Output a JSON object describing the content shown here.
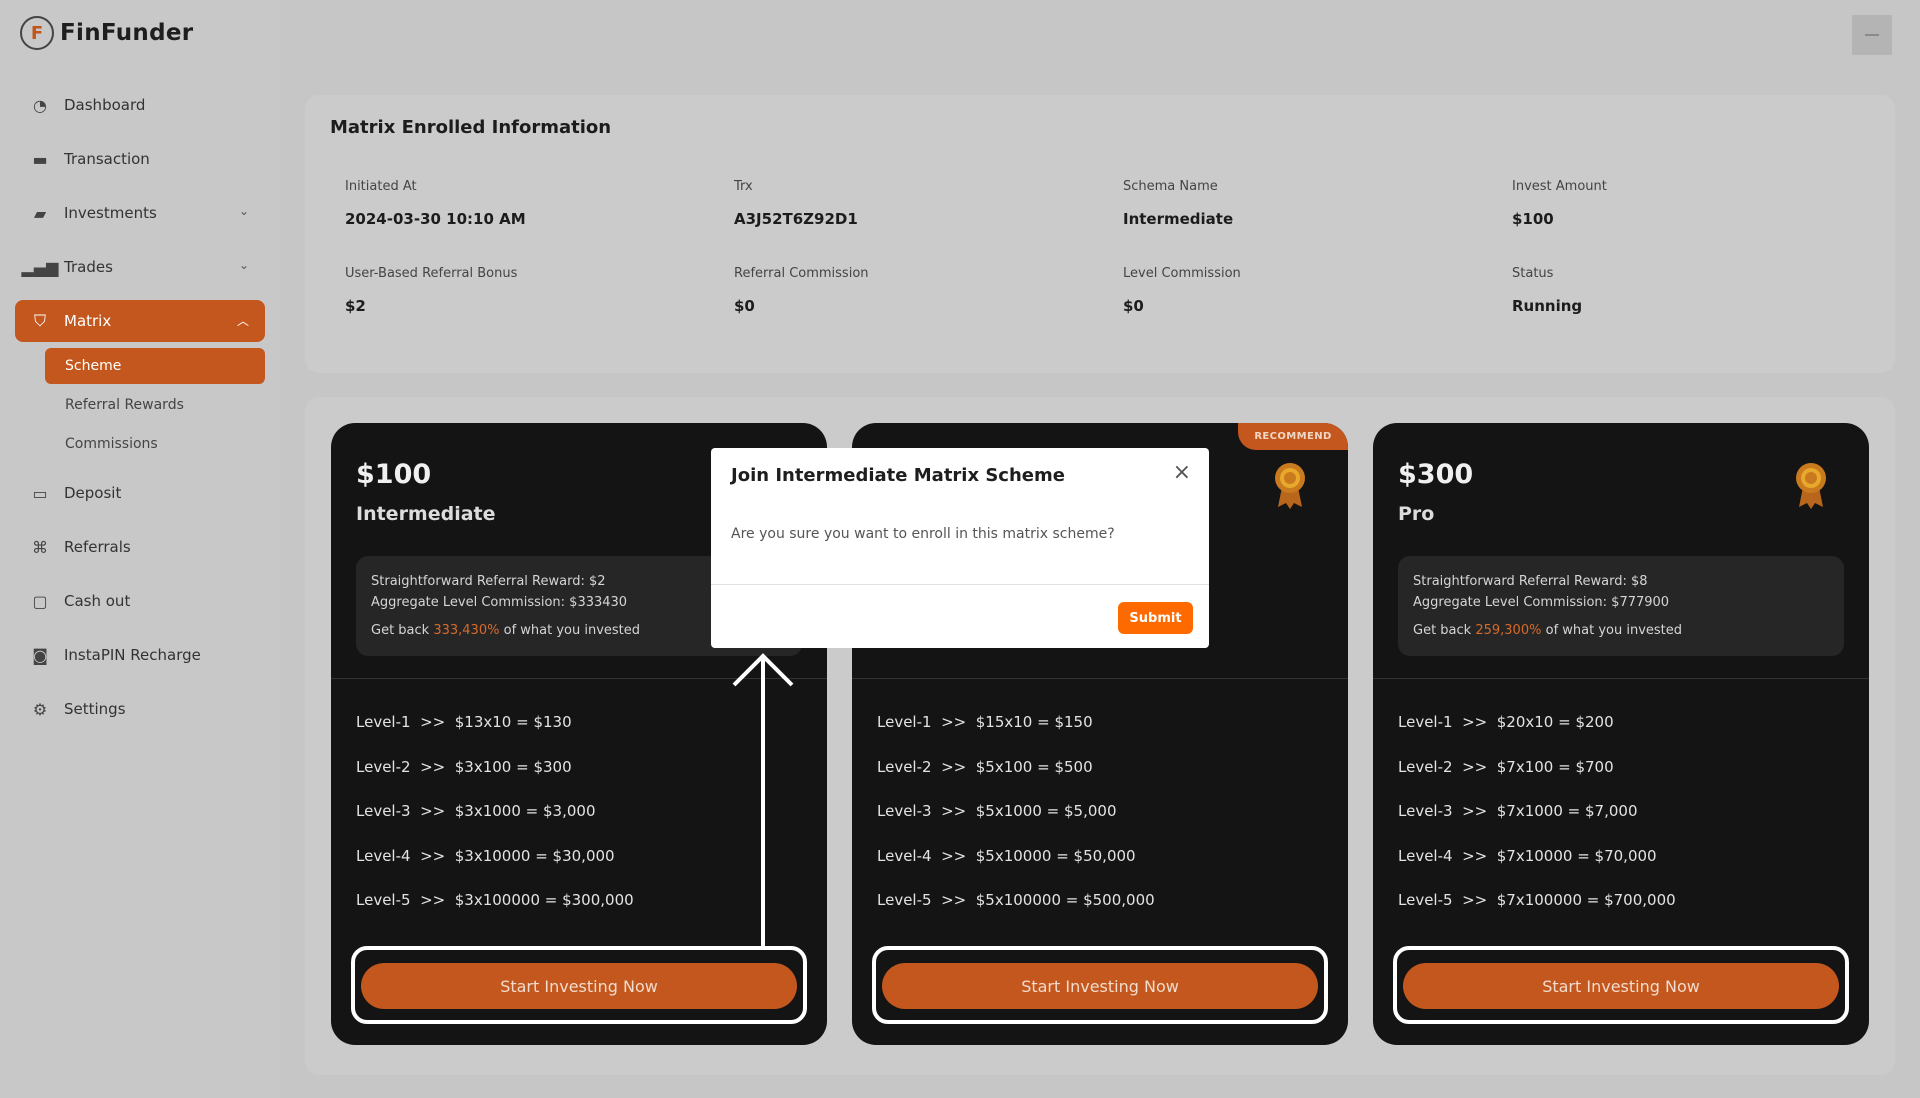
{
  "app": {
    "name": "FinFunder"
  },
  "sidebar": {
    "items": [
      {
        "label": "Dashboard",
        "icon": "dashboard-icon"
      },
      {
        "label": "Transaction",
        "icon": "card-icon"
      },
      {
        "label": "Investments",
        "icon": "wallet-icon"
      },
      {
        "label": "Trades",
        "icon": "bar-chart-icon"
      },
      {
        "label": "Matrix",
        "icon": "shield-icon"
      },
      {
        "label": "Deposit",
        "icon": "folder-icon"
      },
      {
        "label": "Referrals",
        "icon": "command-icon"
      },
      {
        "label": "Cash out",
        "icon": "calendar-icon"
      },
      {
        "label": "InstaPIN Recharge",
        "icon": "pin-card-icon"
      },
      {
        "label": "Settings",
        "icon": "gear-icon"
      }
    ],
    "matrix_sub": [
      "Scheme",
      "Referral Rewards",
      "Commissions"
    ]
  },
  "info": {
    "title": "Matrix Enrolled Information",
    "fields": [
      {
        "label": "Initiated At",
        "value": "2024-03-30 10:10 AM"
      },
      {
        "label": "Trx",
        "value": "A3J52T6Z92D1"
      },
      {
        "label": "Schema Name",
        "value": "Intermediate"
      },
      {
        "label": "Invest Amount",
        "value": "$100"
      },
      {
        "label": "User-Based Referral Bonus",
        "value": "$2"
      },
      {
        "label": "Referral Commission",
        "value": "$0"
      },
      {
        "label": "Level Commission",
        "value": "$0"
      },
      {
        "label": "Status",
        "value": "Running"
      }
    ]
  },
  "plans": [
    {
      "price": "$100",
      "name": "Intermediate",
      "referral": "Straightforward Referral Reward: $2",
      "aggregate": "Aggregate Level Commission: $333430",
      "getback_pre": "Get back",
      "getback_pct": "333,430%",
      "getback_post": "of what you invested",
      "levels": [
        "Level-1  >>  $13x10 = $130",
        "Level-2  >>  $3x100 = $300",
        "Level-3  >>  $3x1000 = $3,000",
        "Level-4  >>  $3x10000 = $30,000",
        "Level-5  >>  $3x100000 = $300,000"
      ],
      "cta": "Start Investing Now"
    },
    {
      "badge": "RECOMMEND",
      "levels": [
        "Level-1  >>  $15x10 = $150",
        "Level-2  >>  $5x100 = $500",
        "Level-3  >>  $5x1000 = $5,000",
        "Level-4  >>  $5x10000 = $50,000",
        "Level-5  >>  $5x100000 = $500,000"
      ],
      "cta": "Start Investing Now"
    },
    {
      "price": "$300",
      "name": "Pro",
      "referral": "Straightforward Referral Reward: $8",
      "aggregate": "Aggregate Level Commission: $777900",
      "getback_pre": "Get back",
      "getback_pct": "259,300%",
      "getback_post": "of what you invested",
      "levels": [
        "Level-1  >>  $20x10 = $200",
        "Level-2  >>  $7x100 = $700",
        "Level-3  >>  $7x1000 = $7,000",
        "Level-4  >>  $7x10000 = $70,000",
        "Level-5  >>  $7x100000 = $700,000"
      ],
      "cta": "Start Investing Now"
    }
  ],
  "modal": {
    "title": "Join Intermediate Matrix Scheme",
    "close": "×",
    "body": "Are you sure you want to enroll in this matrix scheme?",
    "submit": "Submit"
  },
  "colors": {
    "accent": "#c4571d",
    "submit": "#ff6a00",
    "card_bg": "#141414"
  }
}
